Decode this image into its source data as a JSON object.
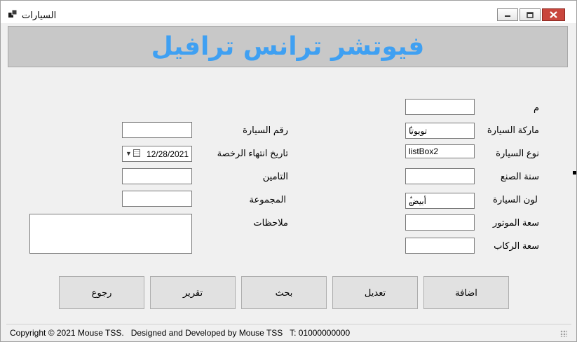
{
  "window": {
    "title": "السيارات"
  },
  "header": {
    "title": "فيوتشر ترانس ترافيل"
  },
  "form_right": {
    "id_label": "م",
    "id_value": "",
    "brand_label": "ماركة السيارة",
    "brand_value": "تويوتا",
    "type_label": "نوع السيارة",
    "type_value": "listBox2",
    "year_label": "سنة الصنع",
    "year_value": "",
    "color_label": "لون السيارة",
    "color_value": "أبيض",
    "engine_label": "سعة الموتور",
    "engine_value": "",
    "seats_label": "سعة الركاب",
    "seats_value": ""
  },
  "form_left": {
    "plate_label": "رقم السيارة",
    "plate_value": "",
    "license_expiry_label": "تاريخ انتهاء الرخصة",
    "license_expiry_value": "12/28/2021",
    "insurance_label": "التامين",
    "insurance_value": "",
    "group_label": "المجموعة",
    "group_value": "",
    "notes_label": "ملاحظات",
    "notes_value": ""
  },
  "buttons": {
    "add": "اضافة",
    "edit": "تعديل",
    "search": "بحث",
    "report": "تقرير",
    "back": "رجوع"
  },
  "statusbar": {
    "text": "Copyright © 2021 Mouse TSS.   Designed and Developed by Mouse TSS   T: 01000000000"
  },
  "icons": {
    "app": "windows-form-icon",
    "minimize": "minimize-icon",
    "maximize": "maximize-icon",
    "close": "close-icon",
    "spin": "spin-arrows-icon",
    "calendar": "calendar-icon",
    "dropdown": "dropdown-triangle-icon",
    "grip": "size-grip-icon"
  },
  "colors": {
    "header_text": "#3fa0f2",
    "header_bg": "#c8c8c8",
    "close_button": "#c9463d"
  }
}
